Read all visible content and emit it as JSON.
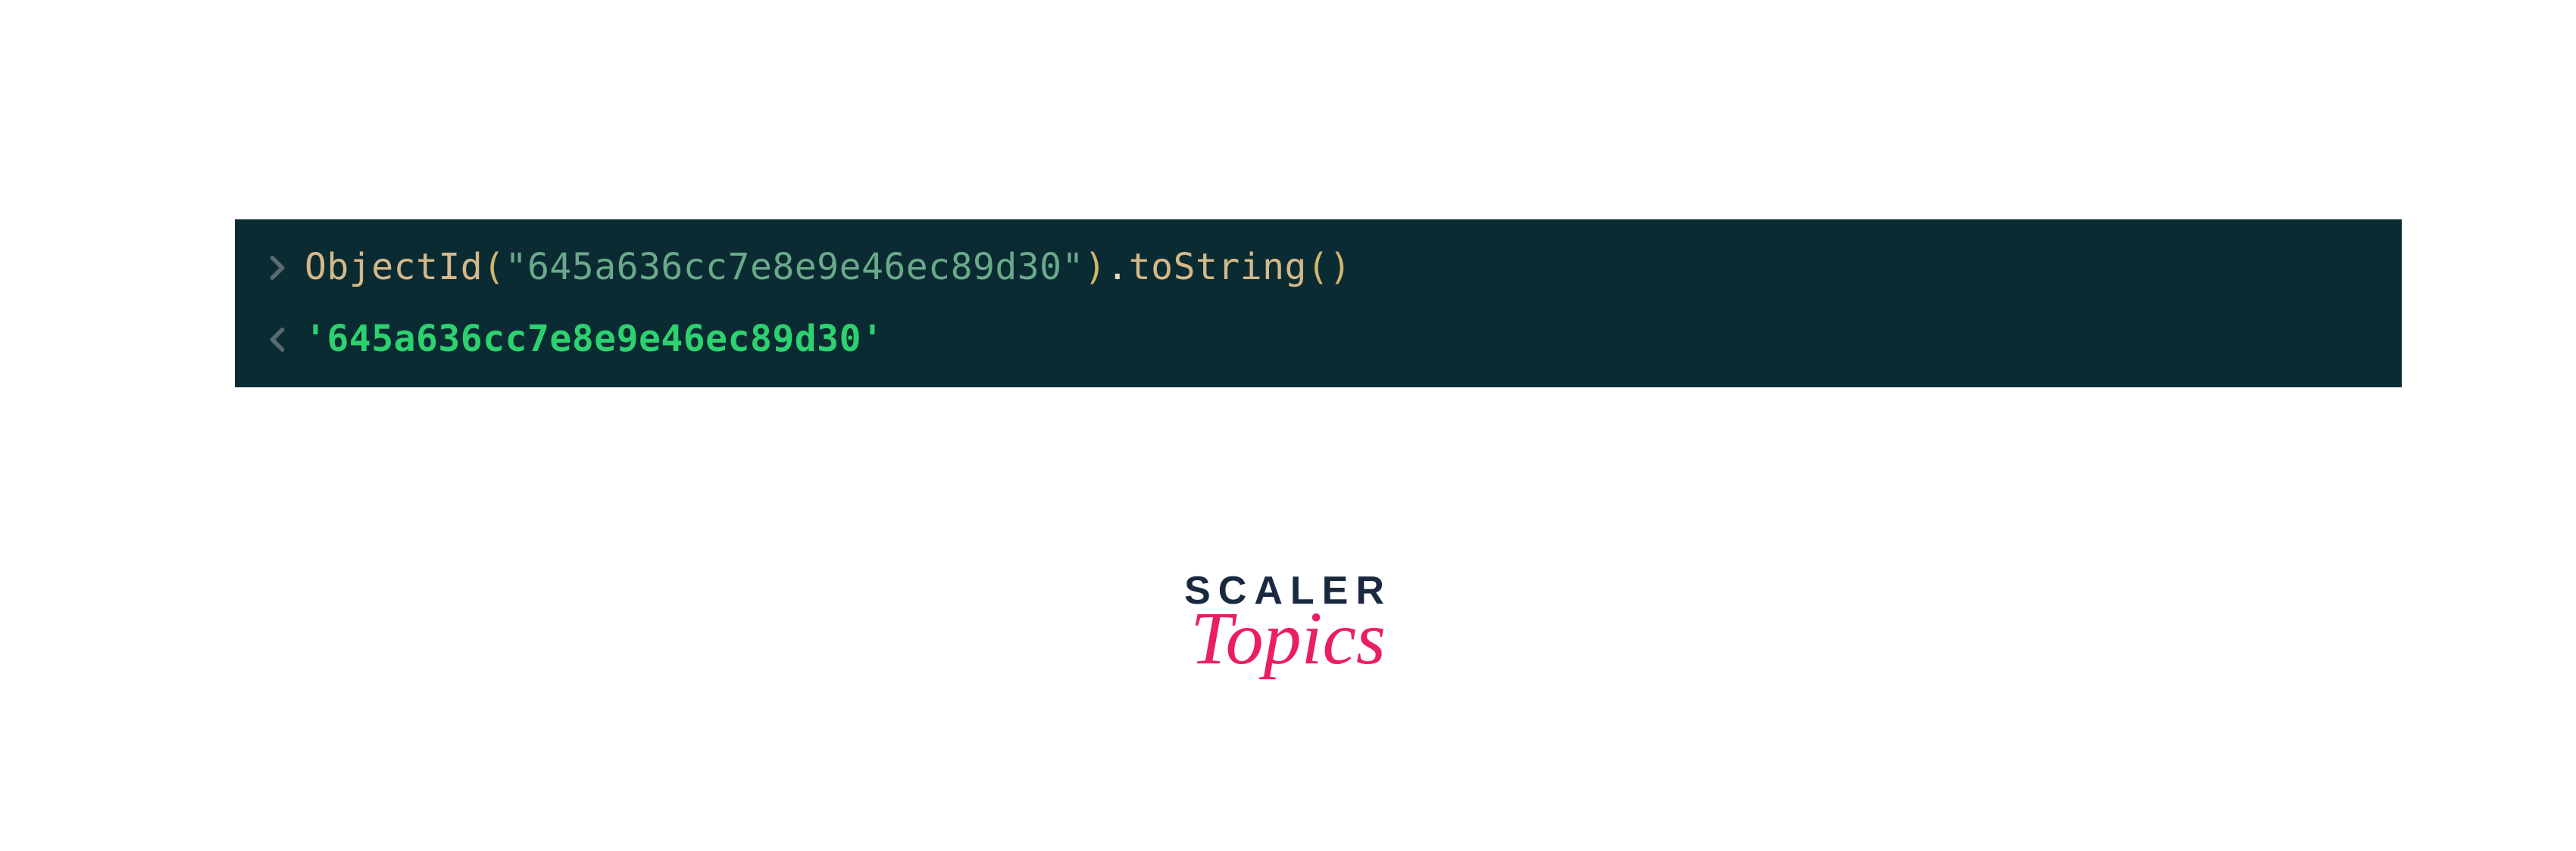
{
  "console": {
    "input": {
      "func": "ObjectId",
      "open_paren": "(",
      "string": "\"645a636cc7e8e9e46ec89d30\"",
      "close_paren": ")",
      "dot": ".",
      "method": "toString",
      "call": "()"
    },
    "output": "'645a636cc7e8e9e46ec89d30'"
  },
  "branding": {
    "scaler": "SCALER",
    "topics": "Topics"
  }
}
